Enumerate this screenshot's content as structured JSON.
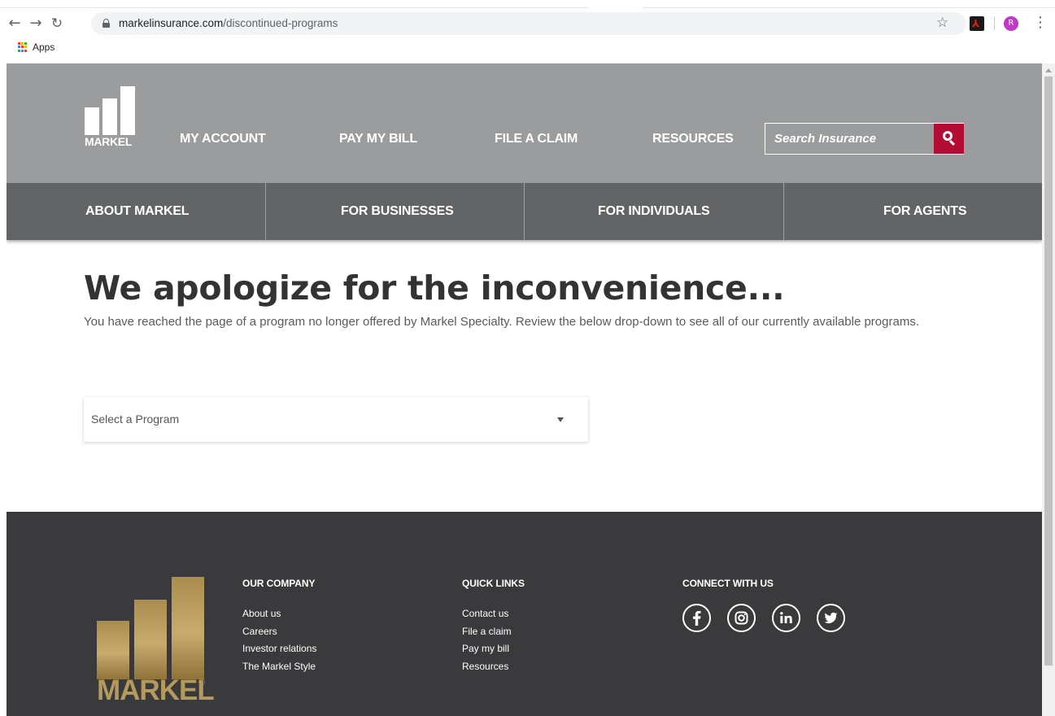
{
  "browser": {
    "url_host": "markelinsurance.com",
    "url_path": "/discontinued-programs",
    "avatar_letter": "R",
    "bookmarks": {
      "apps_label": "Apps"
    }
  },
  "header": {
    "logo_text": "MARKEL",
    "top_links": [
      "MY ACCOUNT",
      "PAY MY BILL",
      "FILE A CLAIM",
      "RESOURCES"
    ],
    "search": {
      "placeholder": "Search Insurance"
    }
  },
  "main_nav": [
    "ABOUT MARKEL",
    "FOR BUSINESSES",
    "FOR INDIVIDUALS",
    "FOR AGENTS"
  ],
  "main": {
    "heading": "We apologize for the inconvenience...",
    "intro": "You have reached the page of a program no longer offered by Markel Specialty. Review the below drop-down to see all of our currently available programs.",
    "program_select": "Select a Program"
  },
  "footer": {
    "logo_text": "MARKEL",
    "logo_reg": "®",
    "company": {
      "heading": "OUR COMPANY",
      "links": [
        "About us",
        "Careers",
        "Investor relations",
        "The Markel Style"
      ]
    },
    "quick": {
      "heading": "QUICK LINKS",
      "links": [
        "Contact us",
        "File a claim",
        "Pay my bill",
        "Resources"
      ]
    },
    "connect": {
      "heading": "CONNECT WITH US",
      "icons": [
        "facebook-icon",
        "instagram-icon",
        "linkedin-icon",
        "twitter-icon"
      ]
    }
  },
  "colors": {
    "header_gray": "#9b9c9e",
    "nav_gray": "#636466",
    "search_red": "#b30d33",
    "footer_bg": "#3a3a3c",
    "gold": "#b59a5d"
  }
}
